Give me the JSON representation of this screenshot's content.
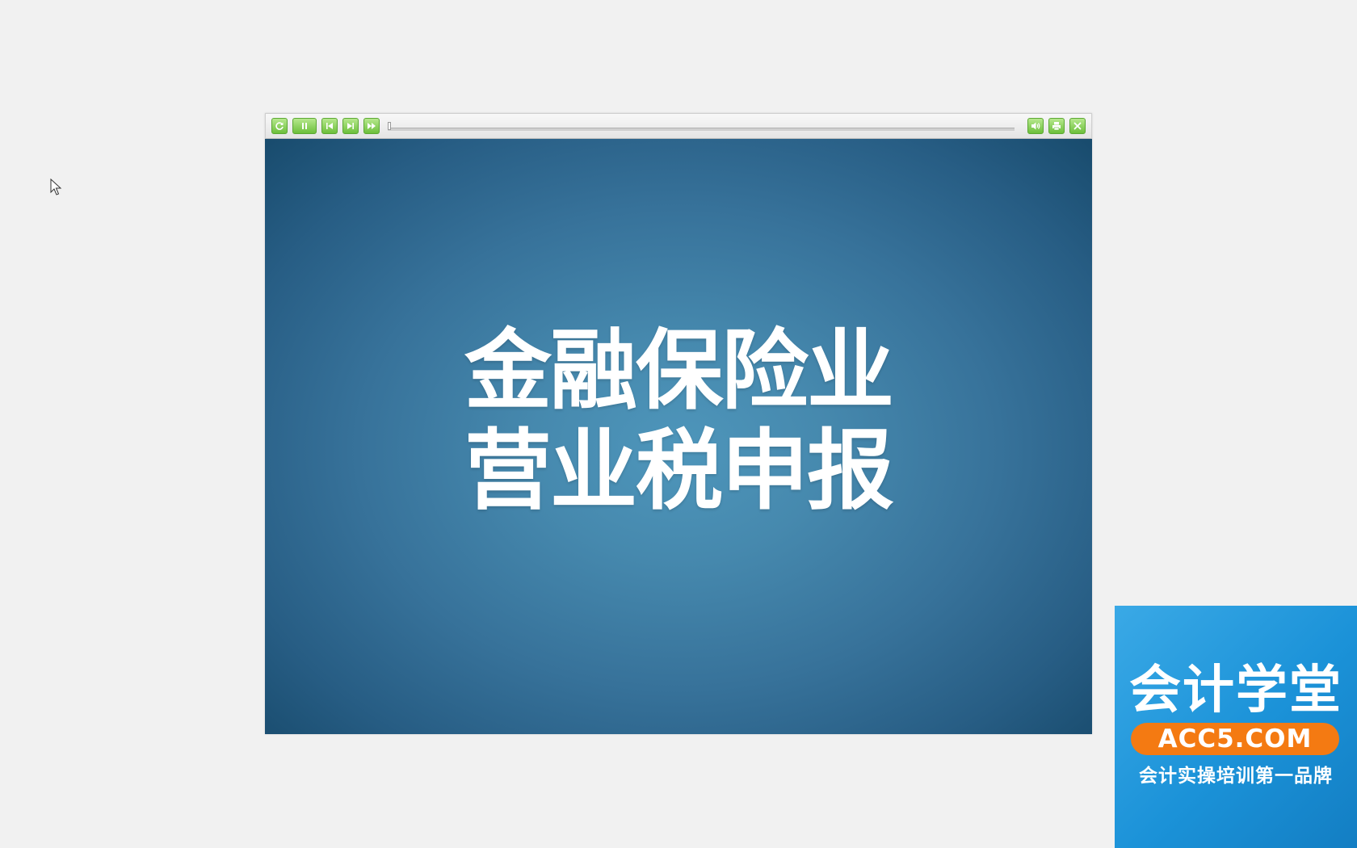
{
  "player": {
    "controls": {
      "replay_icon": "replay-icon",
      "pause_icon": "pause-icon",
      "prev_icon": "skip-back-icon",
      "next_icon": "skip-forward-icon",
      "fast_forward_icon": "fast-forward-icon",
      "volume_icon": "volume-icon",
      "print_icon": "print-icon",
      "close_icon": "close-icon"
    },
    "progress": 0.0,
    "accent_color": "#78c446"
  },
  "slide": {
    "title_line1": "金融保险业",
    "title_line2": "营业税申报",
    "background_color": "#3d7ca3"
  },
  "brand": {
    "name": "会计学堂",
    "url": "ACC5.COM",
    "slogan": "会计实操培训第一品牌",
    "background_color": "#1f96dc",
    "url_badge_color": "#f47a12"
  }
}
